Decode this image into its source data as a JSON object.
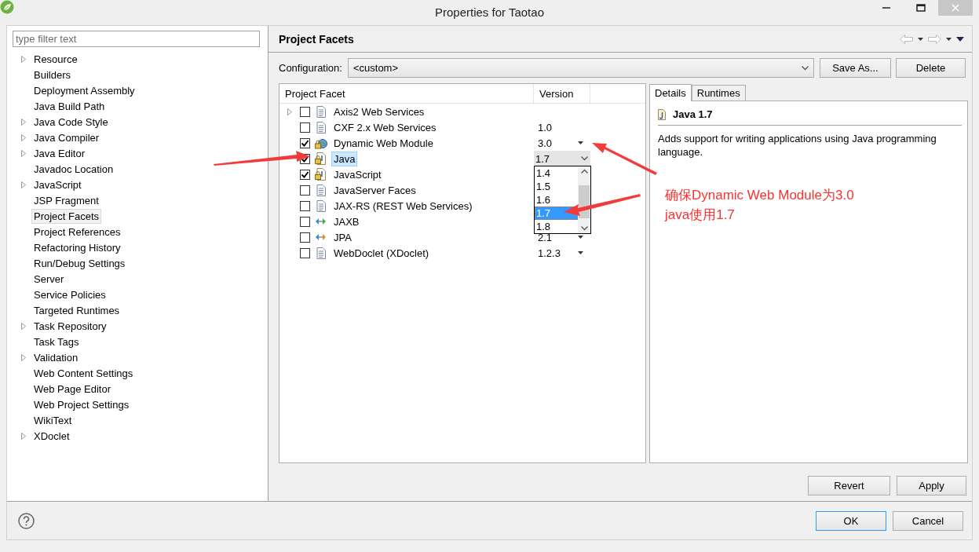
{
  "window": {
    "title": "Properties for Taotao"
  },
  "sidebar": {
    "filter": {
      "placeholder": "type filter text"
    },
    "items": [
      {
        "label": "Resource",
        "expandable": true,
        "selected": false
      },
      {
        "label": "Builders",
        "expandable": false,
        "selected": false
      },
      {
        "label": "Deployment Assembly",
        "expandable": false,
        "selected": false
      },
      {
        "label": "Java Build Path",
        "expandable": false,
        "selected": false
      },
      {
        "label": "Java Code Style",
        "expandable": true,
        "selected": false
      },
      {
        "label": "Java Compiler",
        "expandable": true,
        "selected": false
      },
      {
        "label": "Java Editor",
        "expandable": true,
        "selected": false
      },
      {
        "label": "Javadoc Location",
        "expandable": false,
        "selected": false
      },
      {
        "label": "JavaScript",
        "expandable": true,
        "selected": false
      },
      {
        "label": "JSP Fragment",
        "expandable": false,
        "selected": false
      },
      {
        "label": "Project Facets",
        "expandable": false,
        "selected": true
      },
      {
        "label": "Project References",
        "expandable": false,
        "selected": false
      },
      {
        "label": "Refactoring History",
        "expandable": false,
        "selected": false
      },
      {
        "label": "Run/Debug Settings",
        "expandable": false,
        "selected": false
      },
      {
        "label": "Server",
        "expandable": false,
        "selected": false
      },
      {
        "label": "Service Policies",
        "expandable": false,
        "selected": false
      },
      {
        "label": "Targeted Runtimes",
        "expandable": false,
        "selected": false
      },
      {
        "label": "Task Repository",
        "expandable": true,
        "selected": false
      },
      {
        "label": "Task Tags",
        "expandable": false,
        "selected": false
      },
      {
        "label": "Validation",
        "expandable": true,
        "selected": false
      },
      {
        "label": "Web Content Settings",
        "expandable": false,
        "selected": false
      },
      {
        "label": "Web Page Editor",
        "expandable": false,
        "selected": false
      },
      {
        "label": "Web Project Settings",
        "expandable": false,
        "selected": false
      },
      {
        "label": "WikiText",
        "expandable": false,
        "selected": false
      },
      {
        "label": "XDoclet",
        "expandable": true,
        "selected": false
      }
    ]
  },
  "page": {
    "title": "Project Facets",
    "configuration": {
      "label": "Configuration:",
      "value": "<custom>"
    },
    "buttons": [
      "Save As...",
      "Delete"
    ],
    "table": {
      "columns": [
        "Project Facet",
        "Version"
      ],
      "rows": [
        {
          "name": "Axis2 Web Services",
          "checked": false,
          "expandable": true,
          "kind": "document",
          "selected": false
        },
        {
          "name": "CXF 2.x Web Services",
          "checked": false,
          "expandable": false,
          "kind": "document",
          "version": "1.0",
          "dropdown": false,
          "selected": false
        },
        {
          "name": "Dynamic Web Module",
          "checked": true,
          "expandable": false,
          "kind": "locked-globe",
          "version": "3.0",
          "dropdown": true,
          "selected": false
        },
        {
          "name": "Java",
          "checked": true,
          "expandable": false,
          "kind": "locked-document",
          "version": "1.7",
          "editing": true,
          "selected": true
        },
        {
          "name": "JavaScript",
          "checked": true,
          "expandable": false,
          "kind": "locked-document",
          "selected": false
        },
        {
          "name": "JavaServer Faces",
          "checked": false,
          "expandable": false,
          "kind": "document",
          "selected": false
        },
        {
          "name": "JAX-RS (REST Web Services)",
          "checked": false,
          "expandable": false,
          "kind": "document",
          "selected": false
        },
        {
          "name": "JAXB",
          "checked": false,
          "expandable": false,
          "kind": "green-arrows",
          "selected": false
        },
        {
          "name": "JPA",
          "checked": false,
          "expandable": false,
          "kind": "orange-arrows",
          "version": "2.1",
          "dropdown": true,
          "selected": false
        },
        {
          "name": "WebDoclet (XDoclet)",
          "checked": false,
          "expandable": false,
          "kind": "document",
          "version": "1.2.3",
          "dropdown": true,
          "selected": false
        }
      ]
    },
    "version_list": [
      {
        "label": "1.4",
        "selected": false
      },
      {
        "label": "1.5",
        "selected": false
      },
      {
        "label": "1.6",
        "selected": false
      },
      {
        "label": "1.7",
        "selected": true
      },
      {
        "label": "1.8",
        "selected": false
      }
    ],
    "details": {
      "tabs": [
        {
          "label": "Details",
          "selected": true
        },
        {
          "label": "Runtimes",
          "selected": false
        }
      ],
      "heading": "Java 1.7",
      "description": "Adds support for writing applications using Java programming language."
    },
    "actions": [
      "Revert",
      "Apply"
    ]
  },
  "footer": {
    "buttons": [
      {
        "label": "OK",
        "default": true
      },
      {
        "label": "Cancel",
        "default": false
      }
    ]
  },
  "annotation": {
    "lines": [
      "确保Dynamic Web Module为3.0",
      "java使用1.7"
    ]
  }
}
